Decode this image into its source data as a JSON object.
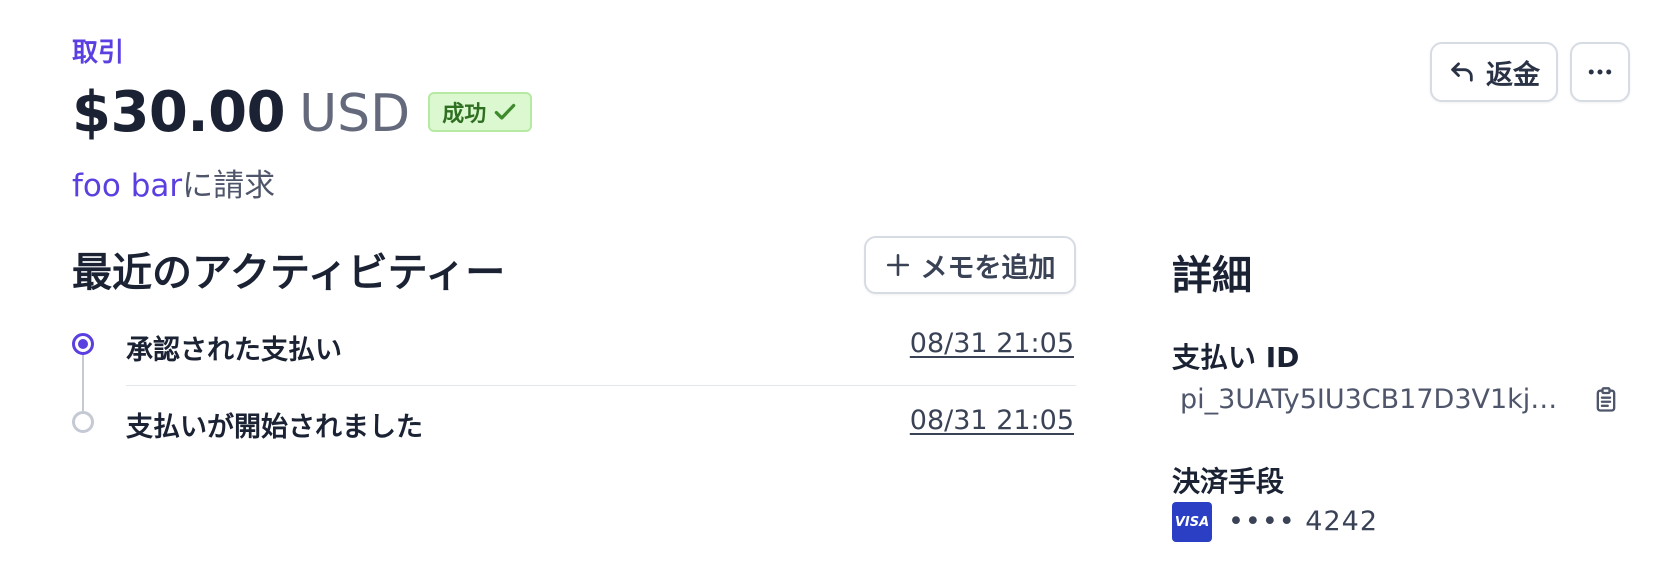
{
  "breadcrumb": "取引",
  "payment": {
    "amount": "$30.00",
    "currency": "USD",
    "status": "成功",
    "customer": "foo bar",
    "charged_suffix": "に請求"
  },
  "actions": {
    "refund_label": "返金"
  },
  "activity": {
    "title": "最近のアクティビティー",
    "add_memo_label": "メモを追加",
    "events": [
      {
        "text": "承認された支払い",
        "time": "08/31 21:05"
      },
      {
        "text": "支払いが開始されました",
        "time": "08/31 21:05"
      }
    ]
  },
  "details": {
    "title": "詳細",
    "payment_id_label": "支払い ID",
    "payment_id": "pi_3UATy5IU3CB17D3V1kjW...",
    "payment_method_label": "決済手段",
    "card_brand": "VISA",
    "card_number": "•••• 4242"
  },
  "colors": {
    "accent": "#5b3fe0",
    "success_bg": "#dcf8d0",
    "success_text": "#2f6f22",
    "visa": "#2a3fc4"
  },
  "icons": [
    "refund-arrow-icon",
    "more-icon",
    "check-icon",
    "plus-icon",
    "clipboard-icon"
  ]
}
